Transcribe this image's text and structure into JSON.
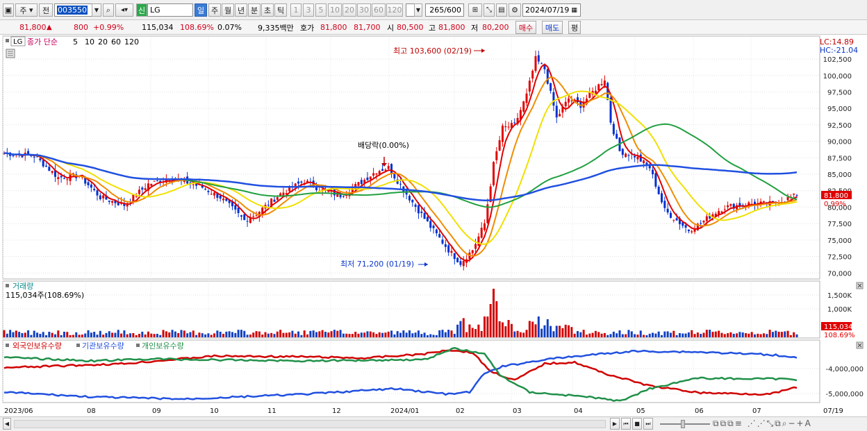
{
  "toolbar": {
    "period_type": "주",
    "adj_label": "전",
    "code": "003550",
    "new_badge": "신",
    "name": "LG",
    "tf_day": "일",
    "tf_week": "주",
    "tf_month": "월",
    "tf_year": "년",
    "tf_min": "분",
    "tf_sec": "초",
    "tf_tick": "틱",
    "n1": "1",
    "n3": "3",
    "n5": "5",
    "n10": "10",
    "n20": "20",
    "n30": "30",
    "n60": "60",
    "n120": "120",
    "count": "265",
    "count_total": "/600",
    "date": "2024/07/19"
  },
  "quote": {
    "price": "81,800",
    "arrow": "▲",
    "change": "800",
    "change_pct": "+0.99%",
    "volume": "115,034",
    "vol_ratio": "108.69%",
    "turnover": "0.07%",
    "amount": "9,335백만",
    "hoga_label": "호가",
    "ask": "81,800",
    "bid": "81,700",
    "open_label": "시",
    "open": "80,500",
    "high_label": "고",
    "high": "81,800",
    "low_label": "저",
    "low": "80,200",
    "buy": "매수",
    "sell": "매도",
    "avg": "평"
  },
  "price_panel": {
    "stock_tag": "LG",
    "legend_label": "종가 단순",
    "ma_values": [
      "5",
      "10",
      "20",
      "60",
      "120"
    ],
    "ma_colors": [
      "#e00000",
      "#f08c00",
      "#f0e000",
      "#20a040",
      "#2050e0"
    ],
    "max_annot": "최고 103,600 (02/19)",
    "min_annot": "최저 71,200 (01/19)",
    "div_annot": "배당락(0.00%)",
    "lc": "LC:14.89",
    "hc": "HC:-21.04",
    "cur_price": "81,800",
    "cur_pct": "0.99%"
  },
  "volume_panel": {
    "title": "거래량",
    "value": "115,034주(108.69%)",
    "cur_vol": "115,034",
    "cur_pct": "108.69%"
  },
  "holding_panel": {
    "series": [
      "외국인보유수량",
      "기관보유수량",
      "개인보유수량"
    ],
    "colors": [
      "#d00000",
      "#2050e0",
      "#20904a"
    ]
  },
  "x_axis": [
    "2023/06",
    "08",
    "09",
    "10",
    "11",
    "12",
    "2024/01",
    "02",
    "03",
    "04",
    "05",
    "06",
    "07",
    "07/19"
  ],
  "chart_data": [
    {
      "type": "candlestick",
      "title": "LG",
      "y_ticks": [
        70000,
        72500,
        75000,
        77500,
        80000,
        82500,
        85000,
        87500,
        90000,
        92500,
        95000,
        97500,
        100000,
        102500
      ],
      "ylim": [
        69500,
        104300
      ],
      "price_anchors": [
        [
          0,
          88200
        ],
        [
          10,
          87800
        ],
        [
          18,
          84500
        ],
        [
          25,
          84800
        ],
        [
          32,
          81500
        ],
        [
          40,
          80300
        ],
        [
          48,
          83500
        ],
        [
          56,
          84500
        ],
        [
          66,
          83000
        ],
        [
          72,
          81500
        ],
        [
          80,
          78000
        ],
        [
          84,
          79000
        ],
        [
          92,
          82000
        ],
        [
          100,
          84000
        ],
        [
          106,
          82500
        ],
        [
          112,
          81800
        ],
        [
          118,
          83500
        ],
        [
          124,
          85500
        ],
        [
          128,
          86000
        ],
        [
          134,
          82000
        ],
        [
          142,
          77000
        ],
        [
          148,
          73500
        ],
        [
          152,
          71500
        ],
        [
          156,
          73500
        ],
        [
          160,
          77500
        ],
        [
          163,
          86500
        ],
        [
          166,
          92000
        ],
        [
          170,
          92500
        ],
        [
          174,
          97000
        ],
        [
          177,
          102500
        ],
        [
          180,
          101000
        ],
        [
          184,
          93500
        ],
        [
          188,
          96500
        ],
        [
          192,
          95500
        ],
        [
          196,
          97500
        ],
        [
          200,
          99500
        ],
        [
          202,
          93000
        ],
        [
          205,
          88500
        ],
        [
          210,
          87800
        ],
        [
          215,
          86000
        ],
        [
          220,
          79500
        ],
        [
          224,
          78000
        ],
        [
          228,
          76500
        ],
        [
          232,
          77500
        ],
        [
          236,
          79000
        ],
        [
          240,
          80000
        ],
        [
          248,
          80500
        ],
        [
          256,
          80500
        ],
        [
          264,
          81800
        ]
      ],
      "annotations": [
        "최고 103,600 (02/19)",
        "최저 71,200 (01/19)",
        "배당락(0.00%)"
      ]
    },
    {
      "type": "bar",
      "title": "거래량",
      "y_ticks": [
        "1,000K",
        "1,500K"
      ],
      "peak": "1,750K",
      "last": 115034
    },
    {
      "type": "line",
      "title": "보유수량",
      "y_ticks": [
        "-4,000,000",
        "-5,000,000"
      ],
      "series": [
        {
          "name": "외국인보유수량"
        },
        {
          "name": "기관보유수량"
        },
        {
          "name": "개인보유수량"
        }
      ]
    }
  ]
}
